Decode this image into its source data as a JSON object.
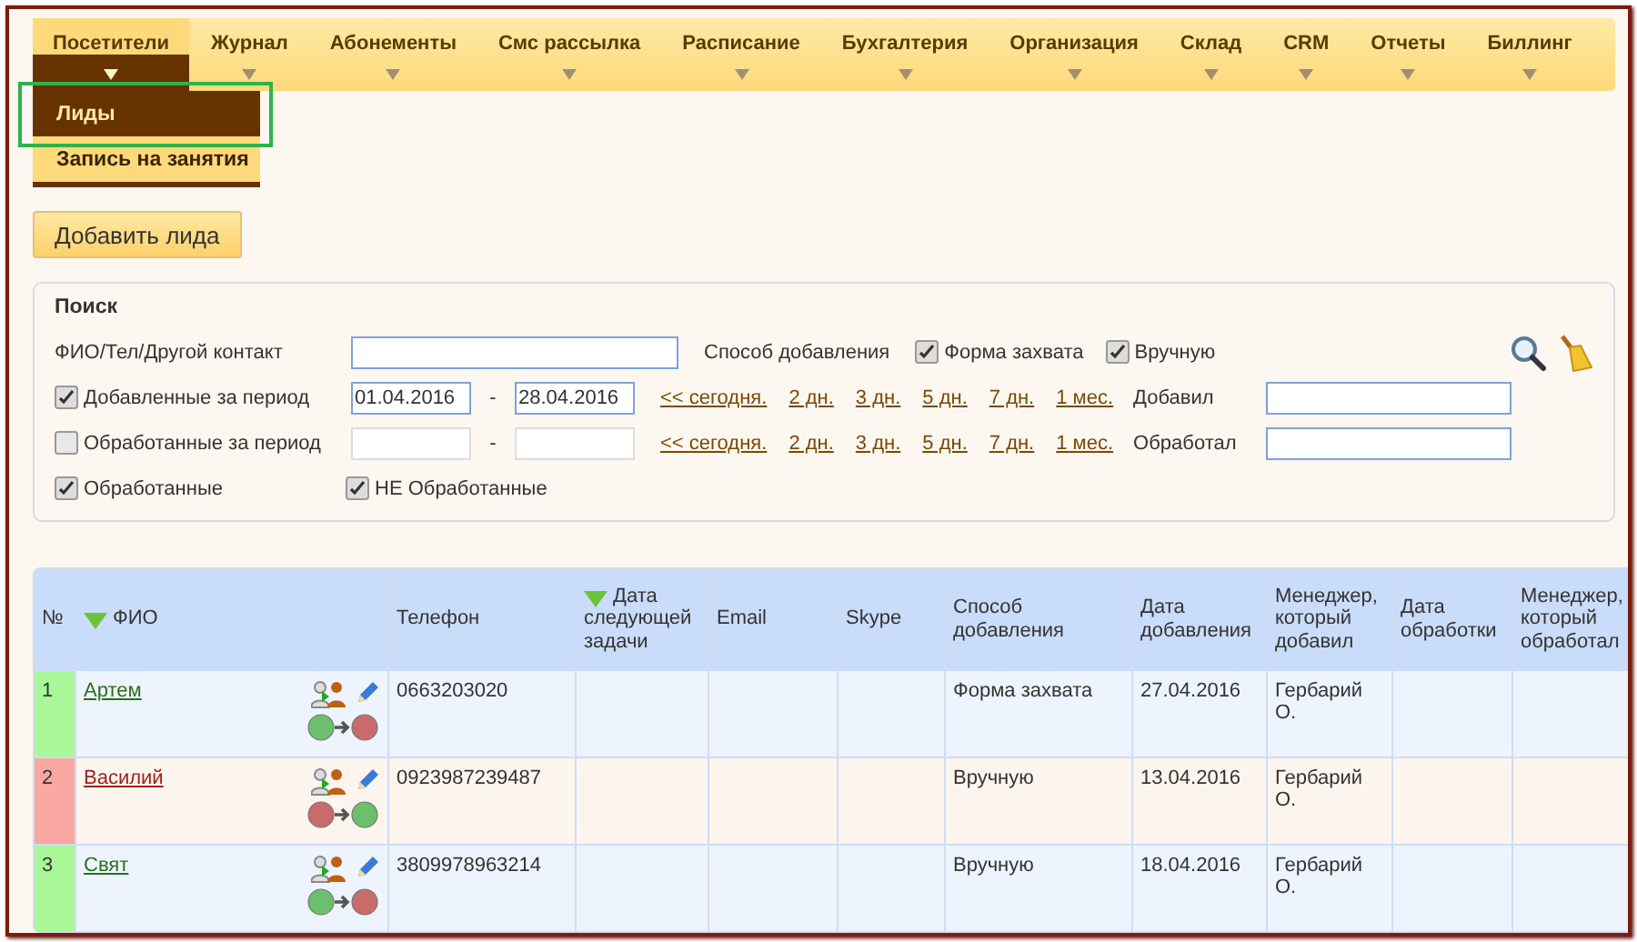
{
  "menu": [
    {
      "label": "Посетители",
      "selected": true
    },
    {
      "label": "Журнал",
      "selected": false
    },
    {
      "label": "Абонементы",
      "selected": false
    },
    {
      "label": "Смс рассылка",
      "selected": false
    },
    {
      "label": "Расписание",
      "selected": false
    },
    {
      "label": "Бухгалтерия",
      "selected": false
    },
    {
      "label": "Организация",
      "selected": false
    },
    {
      "label": "Склад",
      "selected": false
    },
    {
      "label": "CRM",
      "selected": false
    },
    {
      "label": "Отчеты",
      "selected": false
    },
    {
      "label": "Биллинг",
      "selected": false
    }
  ],
  "submenu": [
    {
      "label": "Лиды",
      "selected": true
    },
    {
      "label": "Запись на занятия",
      "selected": false
    }
  ],
  "add_button": "Добавить лида",
  "search": {
    "title": "Поиск",
    "contact_label": "ФИО/Тел/Другой контакт",
    "method_label": "Способ добавления",
    "method_options": [
      {
        "label": "Форма захвата",
        "checked": true
      },
      {
        "label": "Вручную",
        "checked": true
      }
    ],
    "periods": [
      {
        "label": "Добавленные за период",
        "checked": true,
        "from": "01.04.2016",
        "to": "28.04.2016",
        "quick_links": [
          "<< сегодня.",
          "2 дн.",
          "3 дн.",
          "5 дн.",
          "7 дн.",
          "1 мес."
        ],
        "person_label": "Добавил"
      },
      {
        "label": "Обработанные за период",
        "checked": false,
        "quick_links": [
          "<< сегодня.",
          "2 дн.",
          "3 дн.",
          "5 дн.",
          "7 дн.",
          "1 мес."
        ],
        "person_label": "Обработал"
      }
    ],
    "period_dash": "-",
    "status_filters": [
      {
        "label": "Обработанные",
        "checked": true
      },
      {
        "label": "НЕ Обработанные",
        "checked": true
      }
    ]
  },
  "table": {
    "columns": [
      {
        "label": "№",
        "sorted": false
      },
      {
        "label": "ФИО",
        "sorted": true
      },
      {
        "label": "Телефон",
        "sorted": false
      },
      {
        "label": "Дата следующей задачи",
        "sorted": true
      },
      {
        "label": "Email",
        "sorted": false
      },
      {
        "label": "Skype",
        "sorted": false
      },
      {
        "label": "Способ добавления",
        "sorted": false
      },
      {
        "label": "Дата добавления",
        "sorted": false
      },
      {
        "label": "Менеджер, который добавил",
        "sorted": false
      },
      {
        "label": "Дата обработки",
        "sorted": false
      },
      {
        "label": "Менеджер, который обработал",
        "sorted": false
      }
    ],
    "rows": [
      {
        "number": "1",
        "name": "Артем",
        "processed": true,
        "phone": "0663203020",
        "method": "Форма захвата",
        "added": "27.04.2016",
        "manager": "Гербарий О."
      },
      {
        "number": "2",
        "name": "Василий",
        "processed": false,
        "phone": "0923987239487",
        "method": "Вручную",
        "added": "13.04.2016",
        "manager": "Гербарий О."
      },
      {
        "number": "3",
        "name": "Свят",
        "processed": true,
        "phone": "3809978963214",
        "method": "Вручную",
        "added": "18.04.2016",
        "manager": "Гербарий О."
      }
    ]
  }
}
